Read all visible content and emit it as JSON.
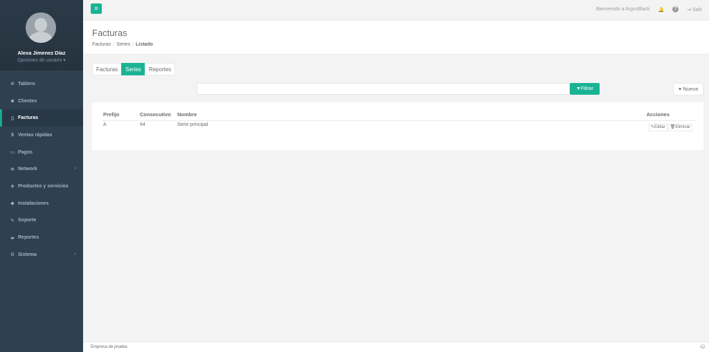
{
  "sidebar": {
    "user_name": "Alexa Jimenez Díaz",
    "user_options": "Opciones de usuario ▾",
    "items": [
      {
        "icon": "tachometer-icon",
        "glyph": "⊙",
        "label": "Tablero"
      },
      {
        "icon": "users-icon",
        "glyph": "☻",
        "label": "Clientes"
      },
      {
        "icon": "file-icon",
        "glyph": "▯",
        "label": "Facturas"
      },
      {
        "icon": "dollar-icon",
        "glyph": "$",
        "label": "Ventas rápidas"
      },
      {
        "icon": "money-icon",
        "glyph": "▭",
        "label": "Pagos"
      },
      {
        "icon": "network-icon",
        "glyph": "✻",
        "label": "Network"
      },
      {
        "icon": "tags-icon",
        "glyph": "◈",
        "label": "Productos y servicios"
      },
      {
        "icon": "install-icon",
        "glyph": "◆",
        "label": "Instalaciones"
      },
      {
        "icon": "wrench-icon",
        "glyph": "✎",
        "label": "Soporte"
      },
      {
        "icon": "reports-icon",
        "glyph": "▰",
        "label": "Reportes"
      },
      {
        "icon": "cogs-icon",
        "glyph": "⚙",
        "label": "Sistema"
      }
    ],
    "arrow": "‹"
  },
  "topbar": {
    "menu_glyph": "≡",
    "welcome": "Bienvenido a ArgusBlack",
    "bell_glyph": "🔔",
    "help_glyph": "?",
    "logout_glyph": "⇥",
    "logout_label": "Salir"
  },
  "heading": {
    "title": "Facturas",
    "breadcrumb": [
      "Facturas",
      "Series",
      "Listado"
    ],
    "sep": "/"
  },
  "tabs": [
    "Facturas",
    "Series",
    "Reportes"
  ],
  "filter": {
    "placeholder": "",
    "button_label": "▼Filtrar",
    "new_plus": "+",
    "new_label": "Nueva"
  },
  "table": {
    "columns": [
      "Prefijo",
      "Consecutivo",
      "Nombre",
      "Acciones"
    ],
    "rows": [
      {
        "prefijo": "A",
        "consecutivo": "64",
        "nombre": "Serie principal",
        "edit_label": "✎Editar",
        "delete_label": "🗑Eliminar"
      }
    ]
  },
  "footer": {
    "company": "Empresa de prueba",
    "icon_glyph": "⛁"
  },
  "colors": {
    "accent": "#1ab394",
    "sidebar": "#2f4050"
  }
}
